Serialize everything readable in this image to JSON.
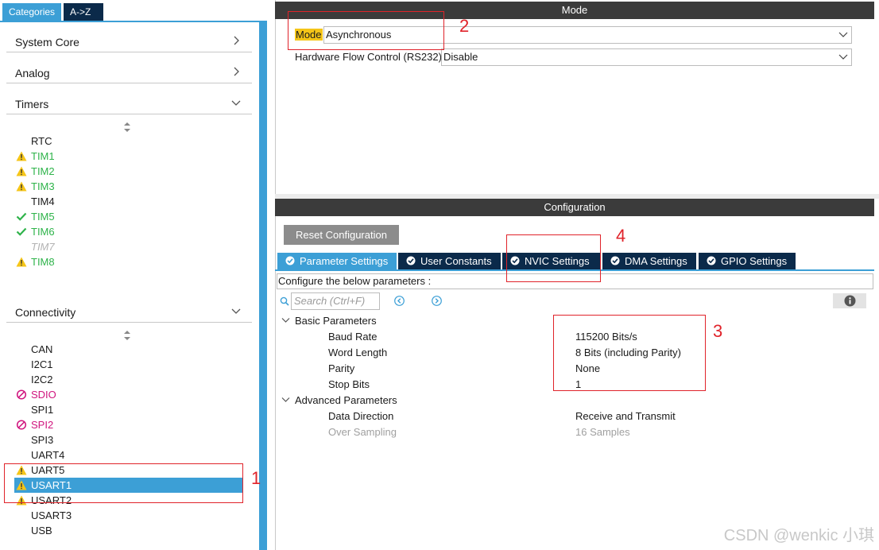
{
  "left_panel": {
    "tabs": [
      {
        "label": "Categories"
      },
      {
        "label": "A->Z"
      }
    ],
    "categories": [
      {
        "label": "System Core"
      },
      {
        "label": "Analog"
      },
      {
        "label": "Timers"
      },
      {
        "label": "Connectivity"
      }
    ],
    "timers": [
      {
        "label": "RTC",
        "status": "none"
      },
      {
        "label": "TIM1",
        "status": "warning"
      },
      {
        "label": "TIM2",
        "status": "warning"
      },
      {
        "label": "TIM3",
        "status": "warning"
      },
      {
        "label": "TIM4",
        "status": "none"
      },
      {
        "label": "TIM5",
        "status": "ok"
      },
      {
        "label": "TIM6",
        "status": "ok"
      },
      {
        "label": "TIM7",
        "status": "disabled"
      },
      {
        "label": "TIM8",
        "status": "warning"
      }
    ],
    "connectivity": [
      {
        "label": "CAN",
        "status": "none"
      },
      {
        "label": "I2C1",
        "status": "none"
      },
      {
        "label": "I2C2",
        "status": "none"
      },
      {
        "label": "SDIO",
        "status": "blocked"
      },
      {
        "label": "SPI1",
        "status": "none"
      },
      {
        "label": "SPI2",
        "status": "blocked"
      },
      {
        "label": "SPI3",
        "status": "none"
      },
      {
        "label": "UART4",
        "status": "none"
      },
      {
        "label": "UART5",
        "status": "warning"
      },
      {
        "label": "USART1",
        "status": "warning-selected"
      },
      {
        "label": "USART2",
        "status": "warning"
      },
      {
        "label": "USART3",
        "status": "none"
      },
      {
        "label": "USB",
        "status": "none"
      }
    ]
  },
  "mode_section": {
    "title": "Mode",
    "mode_label": "Mode",
    "mode_value": "Asynchronous",
    "flow_label": "Hardware Flow Control (RS232)",
    "flow_value": "Disable"
  },
  "config_section": {
    "title": "Configuration",
    "reset_label": "Reset Configuration",
    "tabs": [
      {
        "label": "Parameter Settings"
      },
      {
        "label": "User Constants"
      },
      {
        "label": "NVIC Settings"
      },
      {
        "label": "DMA Settings"
      },
      {
        "label": "GPIO Settings"
      }
    ],
    "description": "Configure the below parameters :",
    "search_placeholder": "Search (Ctrl+F)",
    "groups": [
      {
        "label": "Basic Parameters",
        "params": [
          {
            "name": "Baud Rate",
            "value": "115200 Bits/s"
          },
          {
            "name": "Word Length",
            "value": "8 Bits (including Parity)"
          },
          {
            "name": "Parity",
            "value": "None"
          },
          {
            "name": "Stop Bits",
            "value": "1"
          }
        ]
      },
      {
        "label": "Advanced Parameters",
        "params": [
          {
            "name": "Data Direction",
            "value": "Receive and Transmit"
          },
          {
            "name": "Over Sampling",
            "value": "16 Samples"
          }
        ]
      }
    ]
  },
  "annotations": [
    "1",
    "2",
    "3",
    "4"
  ],
  "watermark": "CSDN @wenkic 小琪",
  "colors": {
    "accent_blue": "#3c9fd6",
    "dark_navy": "#0b2a4a",
    "warning_yellow": "#f5c518",
    "ok_green": "#2eb34a",
    "blocked_pink": "#d0157e",
    "annotation_red": "#e0232a"
  }
}
